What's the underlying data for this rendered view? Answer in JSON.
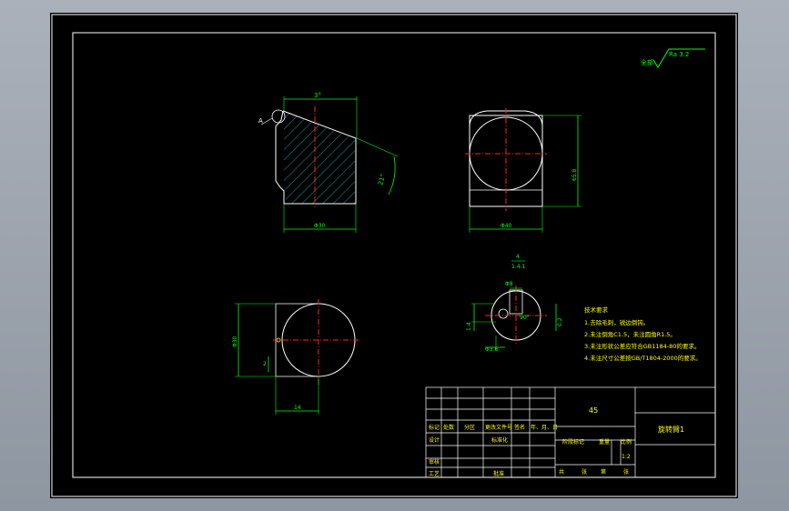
{
  "roughness": {
    "prefix": "全部",
    "value": "Ra 3.2"
  },
  "dimensions": {
    "front_top_angle": "3°",
    "detail_a": "A",
    "front_side_angle": "21°",
    "front_width": "Φ30",
    "side_width": "Φ40",
    "side_height": "65.8",
    "section_top_a": "4",
    "section_top_b": "1.4:1",
    "section_hole": "Φ8",
    "section_angle": "90°",
    "section_left": "1.4",
    "section_right": "0.2",
    "section_bottom": "Φ3.6",
    "top_height": "Φ30",
    "top_small": "2",
    "top_bottom": "14"
  },
  "tech_requirements": {
    "title": "技术要求",
    "items": [
      "1.去除毛刺，锐边倒钝。",
      "2.未注倒角C1.5，未注圆角R1.5。",
      "3.未注形状公差应符合GB1184-80的要求。",
      "4.未注尺寸公差按GB/T1804-2000的要求。"
    ]
  },
  "title_block": {
    "material": "45",
    "part_name": "旋转臂1",
    "row_labels": [
      "标记",
      "处数",
      "分区",
      "更改文件号",
      "签名",
      "年、月、日"
    ],
    "design": "设计",
    "standardize": "标准化",
    "review": "审核",
    "process": "工艺",
    "approve": "批准",
    "stage_mark": "阶段标记",
    "weight": "重量",
    "scale": "比例",
    "scale_value": "1:2",
    "total": "共",
    "sheets": "张",
    "page": "第",
    "sheet2": "张"
  }
}
